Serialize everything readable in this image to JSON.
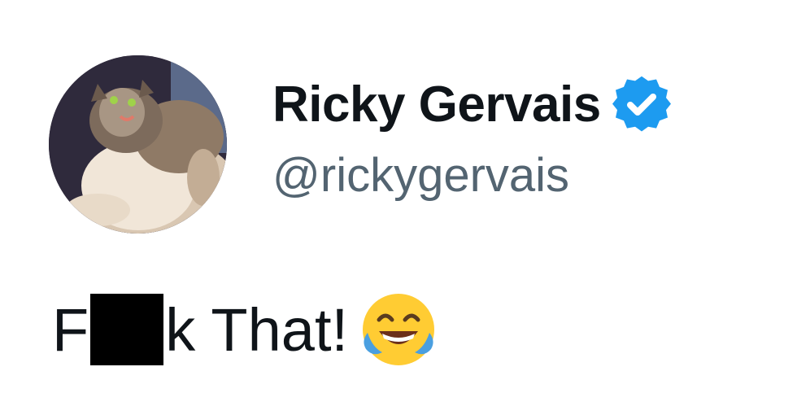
{
  "tweet": {
    "author": {
      "display_name": "Ricky Gervais",
      "handle": "@rickygervais",
      "verified_icon": "verified-badge-icon",
      "avatar": "cat-photo-avatar"
    },
    "text": {
      "prefix": "F",
      "redacted": true,
      "suffix": "k That!",
      "emoji": "face-with-tears-of-joy-emoji"
    }
  },
  "colors": {
    "name": "#0f1419",
    "handle": "#536471",
    "verified": "#1d9bf0",
    "text": "#0f1419",
    "redaction": "#000000"
  }
}
